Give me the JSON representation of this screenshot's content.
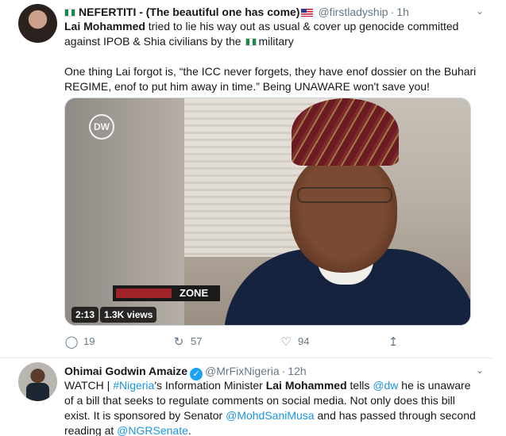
{
  "tweets": [
    {
      "author": {
        "display_name": "NEFERTITI - (The beautiful one has come)",
        "handle": "@firstladyship",
        "time": "1h"
      },
      "text": {
        "p1_bold": "Lai Mohammed",
        "p1_rest": " tried to lie his way out as usual & cover up genocide committed against IPOB & Shia civilians by the ",
        "p1_end": "military",
        "p2": "One thing Lai forgot is, “the ICC never forgets, they have enof dossier on the Buhari REGIME, enof to put him away in time.” Being UNAWARE won't save you!"
      },
      "media": {
        "logo_text": "DW",
        "banner_text": "ZONE",
        "duration": "2:13",
        "views": "1.3K views"
      },
      "actions": {
        "replies": "19",
        "retweets": "57",
        "likes": "94"
      }
    },
    {
      "author": {
        "display_name": "Ohimai Godwin Amaize",
        "handle": "@MrFixNigeria",
        "time": "12h"
      },
      "text": {
        "s1": "WATCH | ",
        "hashtag": "#Nigeria",
        "s2": "'s Information Minister ",
        "bold": "Lai Mohammed",
        "s3": " tells ",
        "mention1": "@dw",
        "s4": " he is unaware of a bill that seeks to regulate comments on social media. Not only does this bill exist. It is sponsored by Senator ",
        "mention2": "@MohdSaniMusa",
        "s5": " and has passed through second reading at ",
        "mention3": "@NGRSenate",
        "s6": "."
      }
    }
  ],
  "icons": {
    "reply": "reply-icon",
    "retweet": "retweet-icon",
    "like": "heart-icon",
    "share": "share-icon",
    "more": "chevron-down-icon",
    "verified": "verified-badge-icon"
  },
  "colors": {
    "link": "#1b95e0",
    "muted": "#657786",
    "verified": "#1da1f2",
    "divider": "#e6ecf0"
  }
}
